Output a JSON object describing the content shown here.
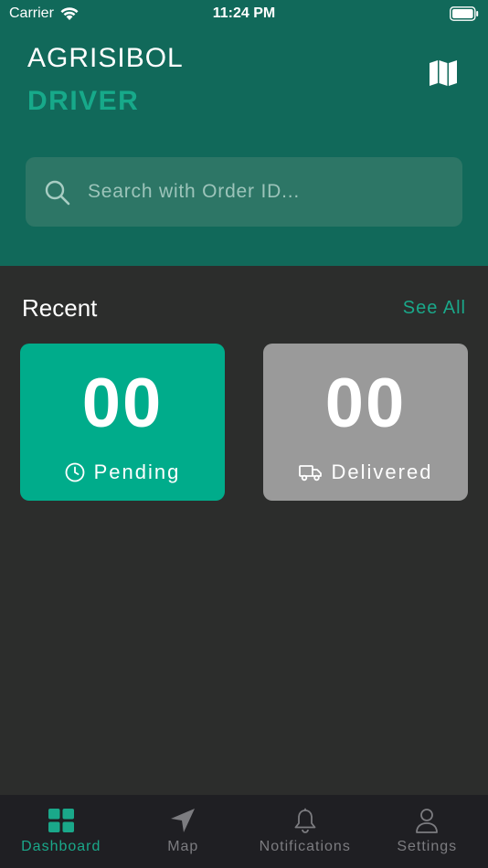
{
  "status_bar": {
    "carrier": "Carrier",
    "time": "11:24 PM"
  },
  "header": {
    "title": "AGRISIBOL",
    "subtitle": "DRIVER"
  },
  "search": {
    "placeholder": "Search with Order ID..."
  },
  "recent": {
    "title": "Recent",
    "see_all": "See All"
  },
  "cards": [
    {
      "count": "00",
      "label": "Pending",
      "icon": "clock-icon",
      "color": "#00ac8b"
    },
    {
      "count": "00",
      "label": "Delivered",
      "icon": "truck-icon",
      "color": "#9a9a9a"
    }
  ],
  "tabs": [
    {
      "label": "Dashboard",
      "icon": "grid-icon",
      "active": true
    },
    {
      "label": "Map",
      "icon": "navigation-arrow-icon",
      "active": false
    },
    {
      "label": "Notifications",
      "icon": "bell-icon",
      "active": false
    },
    {
      "label": "Settings",
      "icon": "user-icon",
      "active": false
    }
  ],
  "colors": {
    "header_bg": "#11695a",
    "accent": "#17a98a",
    "body_bg": "#2c2d2c",
    "tab_bar_bg": "#1f1f23"
  }
}
